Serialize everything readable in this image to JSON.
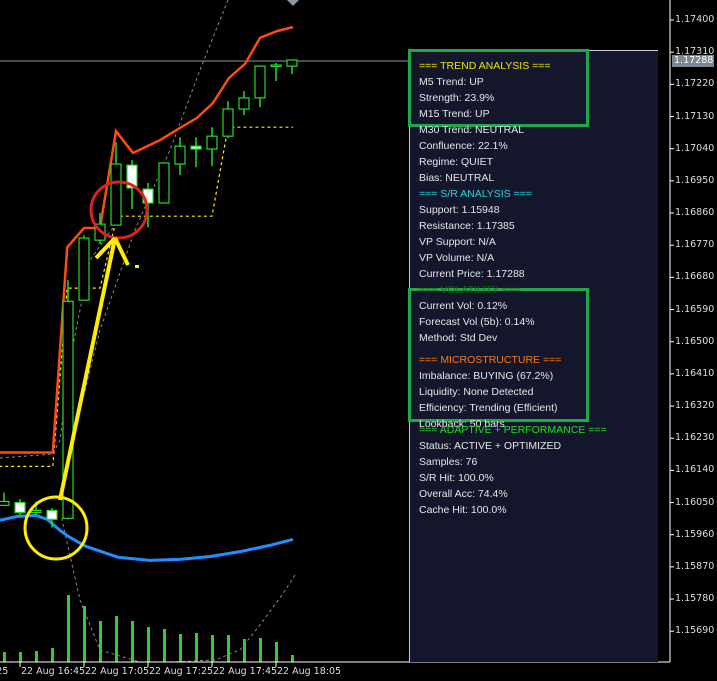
{
  "chart": {
    "symbol_current_price": "1.17288",
    "price_axis": [
      "1.17400",
      "1.17310",
      "1.17220",
      "1.17130",
      "1.17040",
      "1.16950",
      "1.16860",
      "1.16770",
      "1.16680",
      "1.16590",
      "1.16500",
      "1.16410",
      "1.16320",
      "1.16230",
      "1.16140",
      "1.16050",
      "1.15960",
      "1.15870",
      "1.15780",
      "1.15690"
    ],
    "time_axis": [
      ":25",
      "22 Aug 16:45",
      "22 Aug 17:05",
      "22 Aug 17:25",
      "22 Aug 17:45",
      "22 Aug 18:05"
    ],
    "candles": [
      {
        "o": 1.16042,
        "h": 1.16078,
        "l": 1.16042,
        "c": 1.16053
      },
      {
        "o": 1.1605,
        "h": 1.16059,
        "l": 1.16014,
        "c": 1.16022
      },
      {
        "o": 1.16022,
        "h": 1.16053,
        "l": 1.16017,
        "c": 1.16028
      },
      {
        "o": 1.16028,
        "h": 1.16034,
        "l": 1.1598,
        "c": 1.16003
      },
      {
        "o": 1.16006,
        "h": 1.16672,
        "l": 1.16003,
        "c": 1.16613
      },
      {
        "o": 1.16616,
        "h": 1.16798,
        "l": 1.16616,
        "c": 1.1679
      },
      {
        "o": 1.16784,
        "h": 1.1686,
        "l": 1.16773,
        "c": 1.16829
      },
      {
        "o": 1.16826,
        "h": 1.17058,
        "l": 1.16826,
        "c": 1.16997
      },
      {
        "o": 1.16994,
        "h": 1.17008,
        "l": 1.16871,
        "c": 1.1693
      },
      {
        "o": 1.16927,
        "h": 1.16944,
        "l": 1.1682,
        "c": 1.16888
      },
      {
        "o": 1.16888,
        "h": 1.17,
        "l": 1.16888,
        "c": 1.17
      },
      {
        "o": 1.16997,
        "h": 1.17072,
        "l": 1.16966,
        "c": 1.17047
      },
      {
        "o": 1.17047,
        "h": 1.17072,
        "l": 1.16988,
        "c": 1.17039
      },
      {
        "o": 1.17039,
        "h": 1.171,
        "l": 1.16991,
        "c": 1.17075
      },
      {
        "o": 1.17075,
        "h": 1.17173,
        "l": 1.1707,
        "c": 1.17151
      },
      {
        "o": 1.17151,
        "h": 1.17201,
        "l": 1.17134,
        "c": 1.17182
      },
      {
        "o": 1.17182,
        "h": 1.17271,
        "l": 1.17156,
        "c": 1.17271
      },
      {
        "o": 1.17271,
        "h": 1.1728,
        "l": 1.17229,
        "c": 1.17274
      },
      {
        "o": 1.17271,
        "h": 1.17288,
        "l": 1.17249,
        "c": 1.17288
      }
    ],
    "volumes": [
      10,
      10,
      11,
      14,
      67,
      56,
      41,
      46,
      41,
      35,
      33,
      28,
      29,
      27,
      27,
      23,
      24,
      20,
      7
    ],
    "orange_line": [
      [
        -0.3,
        1.1619
      ],
      [
        3.05,
        1.1619
      ],
      [
        3.95,
        1.16764
      ],
      [
        5,
        1.16818
      ],
      [
        6,
        1.16818
      ],
      [
        7,
        1.17089
      ],
      [
        8.06,
        1.17028
      ],
      [
        9.75,
        1.17064
      ],
      [
        11,
        1.17098
      ],
      [
        12.06,
        1.17126
      ],
      [
        13.06,
        1.17168
      ],
      [
        14.06,
        1.17238
      ],
      [
        15.06,
        1.17277
      ],
      [
        16,
        1.1735
      ],
      [
        17.06,
        1.17369
      ],
      [
        18.06,
        1.1738
      ]
    ],
    "support_line": [
      [
        -0.3,
        1.16151
      ],
      [
        3.05,
        1.16151
      ],
      [
        3.95,
        1.1665
      ],
      [
        6,
        1.1665
      ],
      [
        7.06,
        1.16851
      ],
      [
        13,
        1.16851
      ],
      [
        14,
        1.171
      ],
      [
        18.06,
        1.171
      ]
    ],
    "blue_line": [
      [
        -0.3,
        1.16
      ],
      [
        0.8,
        1.16011
      ],
      [
        2,
        1.16014
      ],
      [
        2.7,
        1.16003
      ],
      [
        3.5,
        1.15972
      ],
      [
        4.1,
        1.15953
      ],
      [
        5.1,
        1.15928
      ],
      [
        7.1,
        1.15897
      ],
      [
        9.1,
        1.15888
      ],
      [
        11,
        1.15891
      ],
      [
        12.9,
        1.15899
      ],
      [
        14.8,
        1.15913
      ],
      [
        16.6,
        1.1593
      ],
      [
        18.06,
        1.15947
      ]
    ],
    "colors": {
      "bull": "#22dd22",
      "bear": "#ffffff",
      "orange": "#ff4a10",
      "support": "#ffee00",
      "blue": "#1e90ff",
      "volume": "#33cc33"
    }
  },
  "panel": {
    "lines": [
      {
        "text": "=== TREND ANALYSIS ===",
        "color": "#e8e800"
      },
      {
        "text": "M5 Trend: UP"
      },
      {
        "text": "Strength: 23.9%"
      },
      {
        "text": "M15 Trend: UP"
      },
      {
        "text": "M30 Trend: NEUTRAL"
      },
      {
        "text": "Confluence: 22.1%"
      },
      {
        "text": "Regime: QUIET"
      },
      {
        "text": "Bias: NEUTRAL"
      },
      {
        "text": "=== S/R ANALYSIS ===",
        "color": "#20d8e0"
      },
      {
        "text": "Support: 1.15948"
      },
      {
        "text": "Resistance: 1.17385"
      },
      {
        "text": "VP Support: N/A"
      },
      {
        "text": "VP Volume: N/A"
      },
      {
        "text": "Current Price: 1.17288"
      },
      {
        "text": "=== VOLATILITY ===",
        "color": "#136b13"
      },
      {
        "text": "Current Vol: 0.12%"
      },
      {
        "text": "Forecast Vol (5b): 0.14%"
      },
      {
        "text": "Method: Std Dev"
      },
      {
        "text": "=== MICROSTRUCTURE ===",
        "color": "#ff7a10",
        "gap": true
      },
      {
        "text": "Imbalance: BUYING (67.2%)"
      },
      {
        "text": "Liquidity: None Detected"
      },
      {
        "text": "Efficiency: Trending (Efficient)"
      },
      {
        "text": "Lookback: 50 bars"
      },
      {
        "text": "=== ADAPTIVE + PERFORMANCE ===",
        "color": "#22dd22",
        "overlap": true
      },
      {
        "text": "Status: ACTIVE + OPTIMIZED"
      },
      {
        "text": "Samples: 76"
      },
      {
        "text": "S/R Hit: 100.0%"
      },
      {
        "text": "Overall Acc: 74.4%"
      },
      {
        "text": "Cache Hit: 100.0%"
      }
    ]
  }
}
